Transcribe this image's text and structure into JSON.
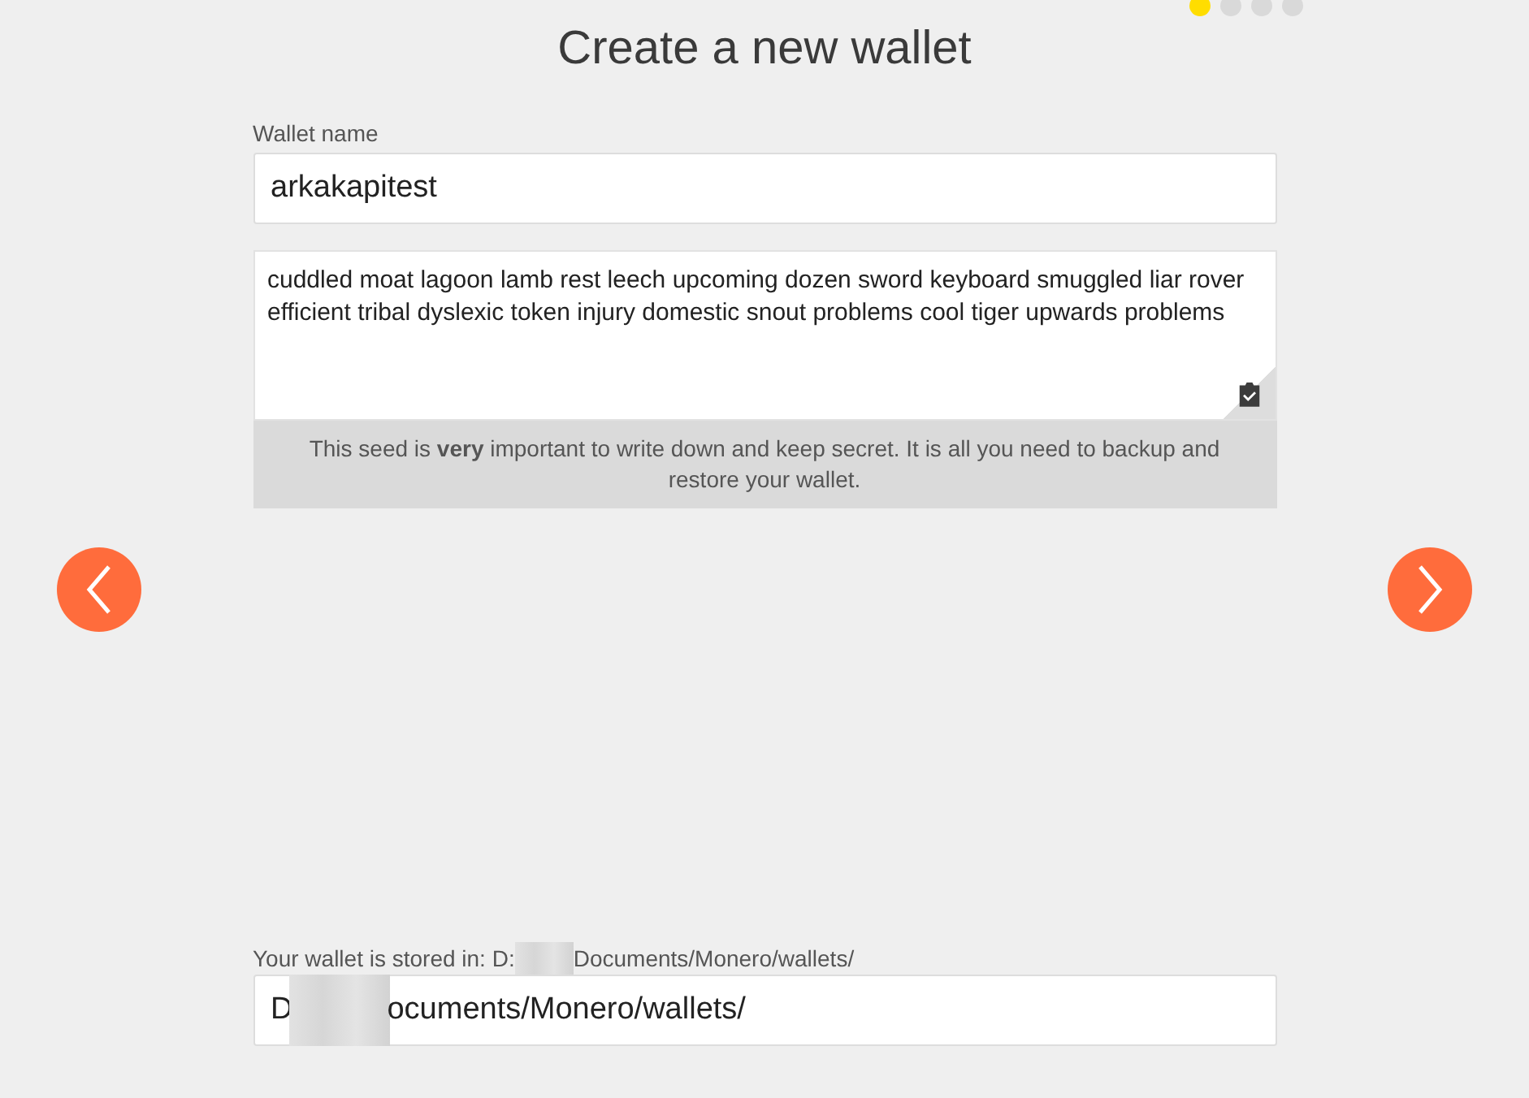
{
  "page_dots": [
    {
      "selected": true
    },
    {
      "selected": false
    },
    {
      "selected": false
    },
    {
      "selected": false
    }
  ],
  "title": "Create a new wallet",
  "wallet_name": {
    "label": "Wallet name",
    "value": "arkakapitest"
  },
  "seed": {
    "text": "cuddled moat lagoon lamb rest leech upcoming dozen sword keyboard smuggled liar rover efficient tribal dyslexic token injury domestic snout problems cool tiger upwards problems",
    "note": "This seed is **very** important to write down and keep secret. It is all you need to backup and restore your wallet."
  },
  "storage": {
    "label_start": "Your wallet is stored in: D:",
    "label_end": "Documents/Monero/wallets/",
    "value_start": "D",
    "value_end": "ocuments/Monero/wallets/"
  }
}
